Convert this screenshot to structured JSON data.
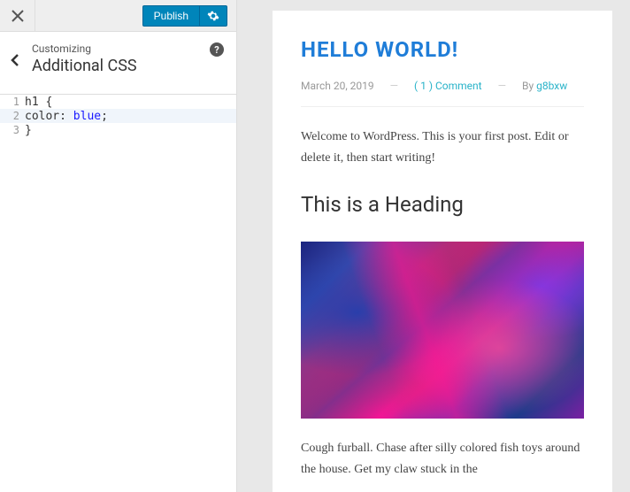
{
  "topbar": {
    "publish_label": "Publish"
  },
  "header": {
    "customizing_label": "Customizing",
    "section_title": "Additional CSS"
  },
  "code": {
    "lines": [
      {
        "num": "1",
        "selector": "h1",
        "punc": " {"
      },
      {
        "num": "2",
        "prop": "color",
        "sep": ": ",
        "val": "blue",
        "end": ";"
      },
      {
        "num": "3",
        "punc": "}"
      }
    ]
  },
  "post": {
    "title": "HELLO WORLD!",
    "date": "March 20, 2019",
    "comments": "( 1 ) Comment",
    "by_label": "By",
    "author": "g8bxw",
    "intro": "Welcome to WordPress. This is your first post. Edit or delete it, then start writing!",
    "heading": "This is a Heading",
    "body2": "Cough furball. Chase after silly colored fish toys around the house. Get my claw stuck in the"
  },
  "meta_separator": "—"
}
